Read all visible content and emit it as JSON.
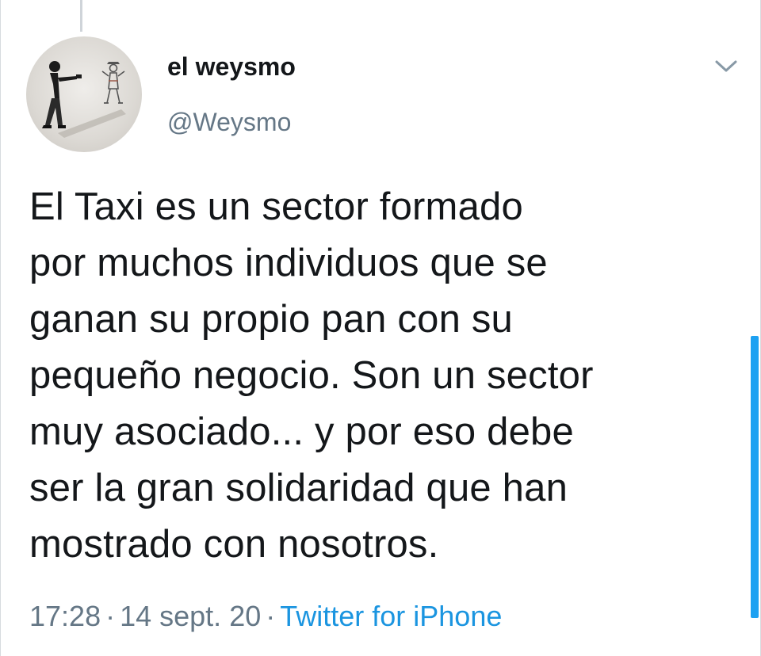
{
  "tweet": {
    "display_name": "el weysmo",
    "handle": "@Weysmo",
    "text_lines": [
      "El Taxi es un sector formado",
      "por muchos individuos que se",
      "ganan su propio pan con su",
      "pequeño negocio. Son un sector",
      "muy asociado... y por eso debe",
      "ser la gran solidaridad que han",
      "mostrado con nosotros."
    ],
    "time": "17:28",
    "date": "14 sept. 20",
    "separator": "·",
    "source": "Twitter for iPhone"
  },
  "icons": {
    "more": "chevron-down-icon",
    "avatar": "avatar-image"
  },
  "colors": {
    "text": "#14171a",
    "muted": "#657786",
    "link": "#1b95e0",
    "scrollbar": "#1da1f2"
  }
}
